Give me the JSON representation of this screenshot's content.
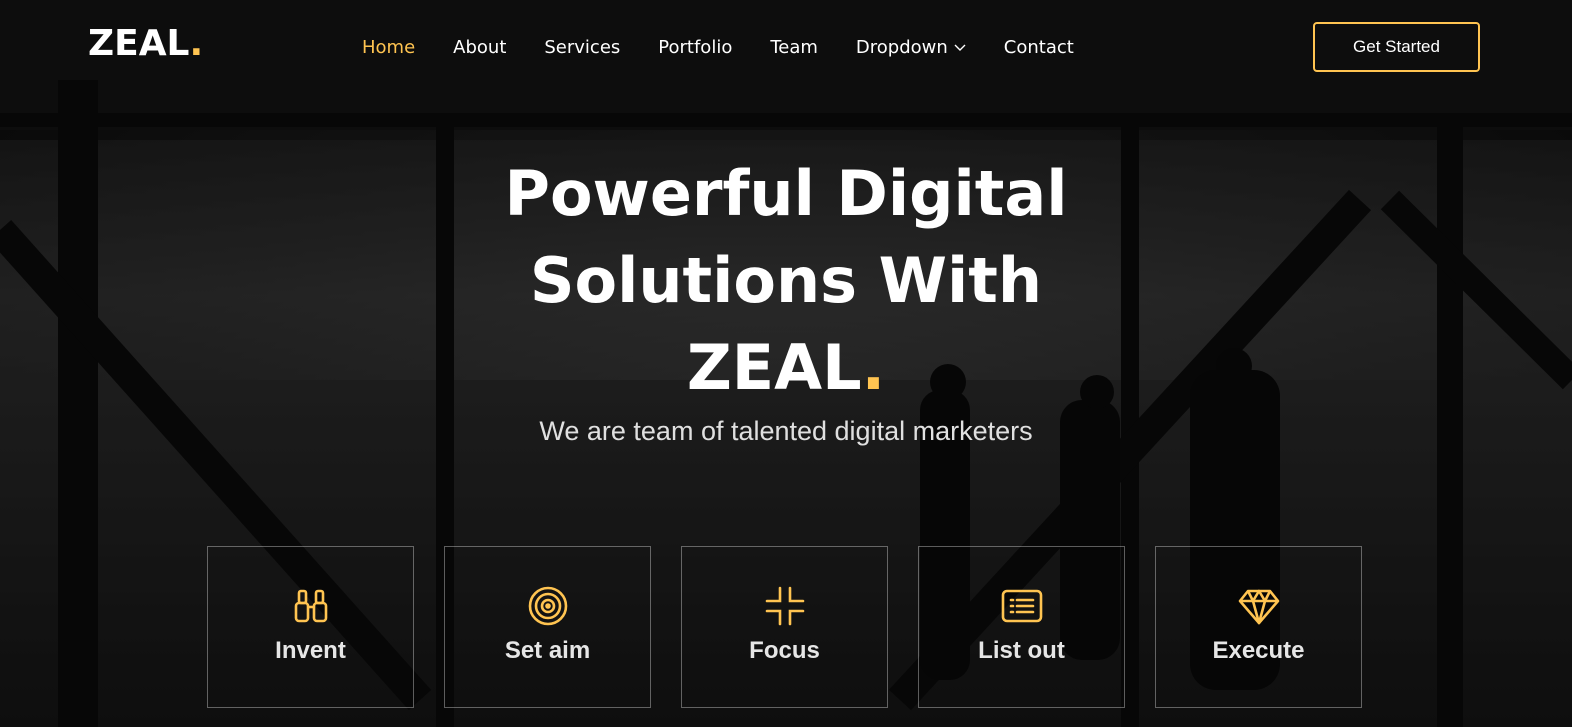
{
  "brand": {
    "name": "ZEAL",
    "dot": ".",
    "accent": "#ffc451"
  },
  "nav": {
    "items": [
      {
        "label": "Home",
        "active": true
      },
      {
        "label": "About"
      },
      {
        "label": "Services"
      },
      {
        "label": "Portfolio"
      },
      {
        "label": "Team"
      },
      {
        "label": "Dropdown",
        "icon": "chevron-down-icon"
      },
      {
        "label": "Contact"
      }
    ],
    "cta": "Get Started"
  },
  "hero": {
    "title_line1": "Powerful Digital",
    "title_line2": "Solutions With",
    "title_line3": "ZEAL",
    "title_dot": ".",
    "subtitle": "We are team of talented digital marketers"
  },
  "features": [
    {
      "label": "Invent",
      "icon": "binoculars-icon"
    },
    {
      "label": "Set aim",
      "icon": "target-icon"
    },
    {
      "label": "Focus",
      "icon": "focus-icon"
    },
    {
      "label": "List out",
      "icon": "list-card-icon"
    },
    {
      "label": "Execute",
      "icon": "gem-icon"
    }
  ]
}
